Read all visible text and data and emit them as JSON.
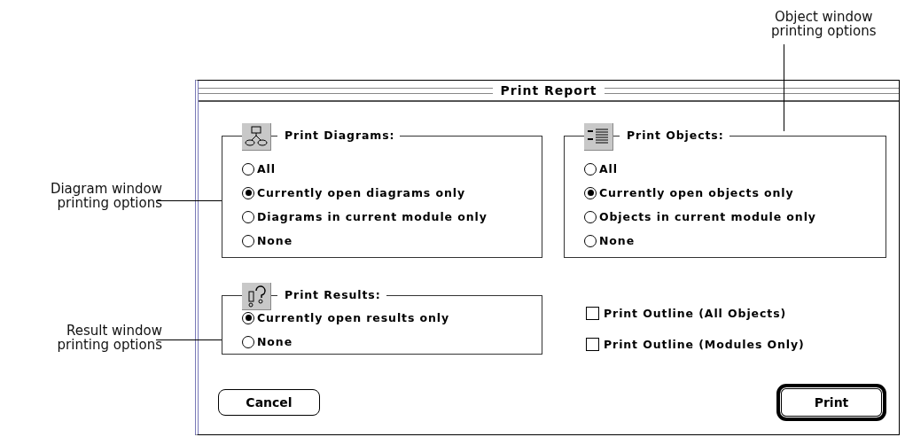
{
  "callouts": [
    {
      "kind": "top",
      "text": "Object window\nprinting options"
    },
    {
      "kind": "diagrams",
      "text": "Diagram window\nprinting options"
    },
    {
      "kind": "results",
      "text": "Result window\nprinting options"
    }
  ],
  "window": {
    "title": "Print Report"
  },
  "groups": [
    {
      "kind": "diagram",
      "title": "Print Diagrams:",
      "options": [
        {
          "label": "All",
          "selected": false
        },
        {
          "label": "Currently open diagrams only",
          "selected": true
        },
        {
          "label": "Diagrams in current module only",
          "selected": false
        },
        {
          "label": "None",
          "selected": false
        }
      ]
    },
    {
      "kind": "objects",
      "title": "Print Objects:",
      "options": [
        {
          "label": "All",
          "selected": false
        },
        {
          "label": "Currently open objects only",
          "selected": true
        },
        {
          "label": "Objects in current module only",
          "selected": false
        },
        {
          "label": "None",
          "selected": false
        }
      ]
    },
    {
      "kind": "results",
      "title": "Print Results:",
      "options": [
        {
          "label": "Currently open results only",
          "selected": true
        },
        {
          "label": "None",
          "selected": false
        }
      ]
    }
  ],
  "checkboxes": [
    {
      "label": "Print Outline (All Objects)",
      "checked": false
    },
    {
      "label": "Print Outline (Modules Only)",
      "checked": false
    }
  ],
  "buttons": [
    {
      "label": "Cancel",
      "default": false
    },
    {
      "label": "Print",
      "default": true
    }
  ]
}
